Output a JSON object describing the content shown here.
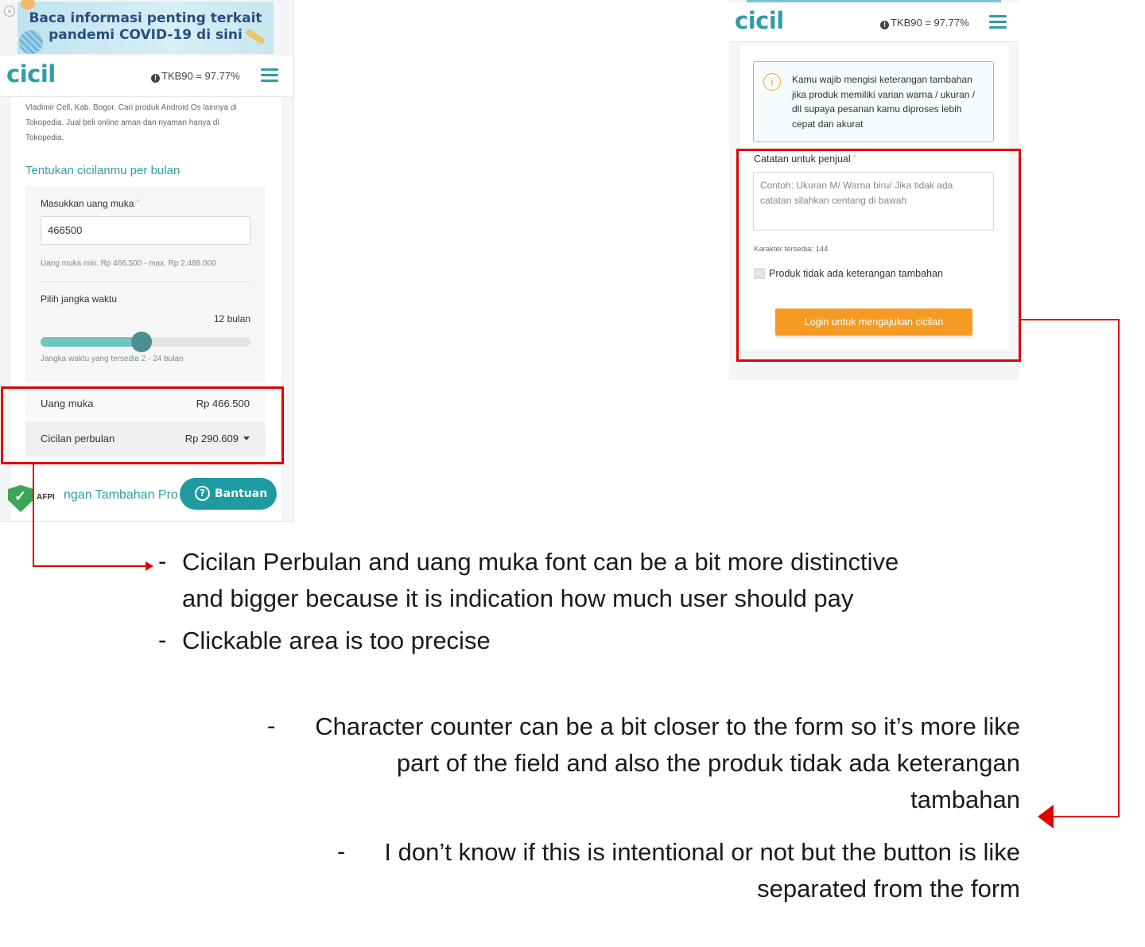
{
  "left_phone": {
    "banner": {
      "text": "Baca informasi penting terkait pandemi COVID-19 di sini"
    },
    "header": {
      "logo": "cicil",
      "tkb": "TKB90 = 97.77%"
    },
    "description": "Vladimir Cell, Kab. Bogor. Cari produk Android Os lainnya di Tokopedia. Jual beli online aman dan nyaman hanya di Tokopedia.",
    "section_title": "Tentukan cicilanmu per bulan",
    "down_payment": {
      "label": "Masukkan uang muka",
      "required_mark": "*",
      "value": "466500",
      "hint": "Uang muka min. Rp 466.500 - max. Rp 2.488.000"
    },
    "term": {
      "label": "Pilih jangka waktu",
      "value": "12 bulan",
      "hint": "Jangka waktu yang tersedia 2 - 24 bulan",
      "slider_fraction": 0.48
    },
    "summary": [
      {
        "label": "Uang muka",
        "value": "Rp 466.500"
      },
      {
        "label": "Cicilan perbulan",
        "value": "Rp 290.609"
      }
    ],
    "bottom": {
      "afpi": "AFPI",
      "partial_text": "ngan Tambahan Pro",
      "help_button": "Bantuan"
    }
  },
  "right_phone": {
    "header": {
      "logo": "cicil",
      "tkb": "TKB90 = 97.77%"
    },
    "info_text": "Kamu wajib mengisi keterangan tambahan jika produk memiliki varian warna / ukuran / dll supaya pesanan kamu diproses lebih cepat dan akurat",
    "notes_label": "Catatan untuk penjual",
    "required_mark": "*",
    "notes_placeholder": "Contoh: Ukuran M/ Warna biru/ Jika tidak ada catatan silahkan centang di bawah",
    "char_counter": "Karakter tersedia: 144",
    "checkbox_label": "Produk tidak ada keterangan tambahan",
    "login_button": "Login untuk mengajukan cicilan"
  },
  "annotations": {
    "note1_line1": "Cicilan Perbulan and uang muka font can be a bit more distinctive",
    "note1_line2": "and bigger because it is indication how much user should pay",
    "note2": "Clickable area is too precise",
    "note3_line1": "Character counter can be a bit closer to the form so it’s more like",
    "note3_line2": "part of the field and also the produk tidak ada keterangan",
    "note3_line3": "tambahan",
    "note4_line1": "I don’t know if this is intentional or not but the button is like",
    "note4_line2": "separated from the form",
    "dash": "-"
  },
  "colors": {
    "brand_teal": "#2e9ea6",
    "accent_orange": "#f59a23",
    "annotation_red": "#e00000"
  }
}
